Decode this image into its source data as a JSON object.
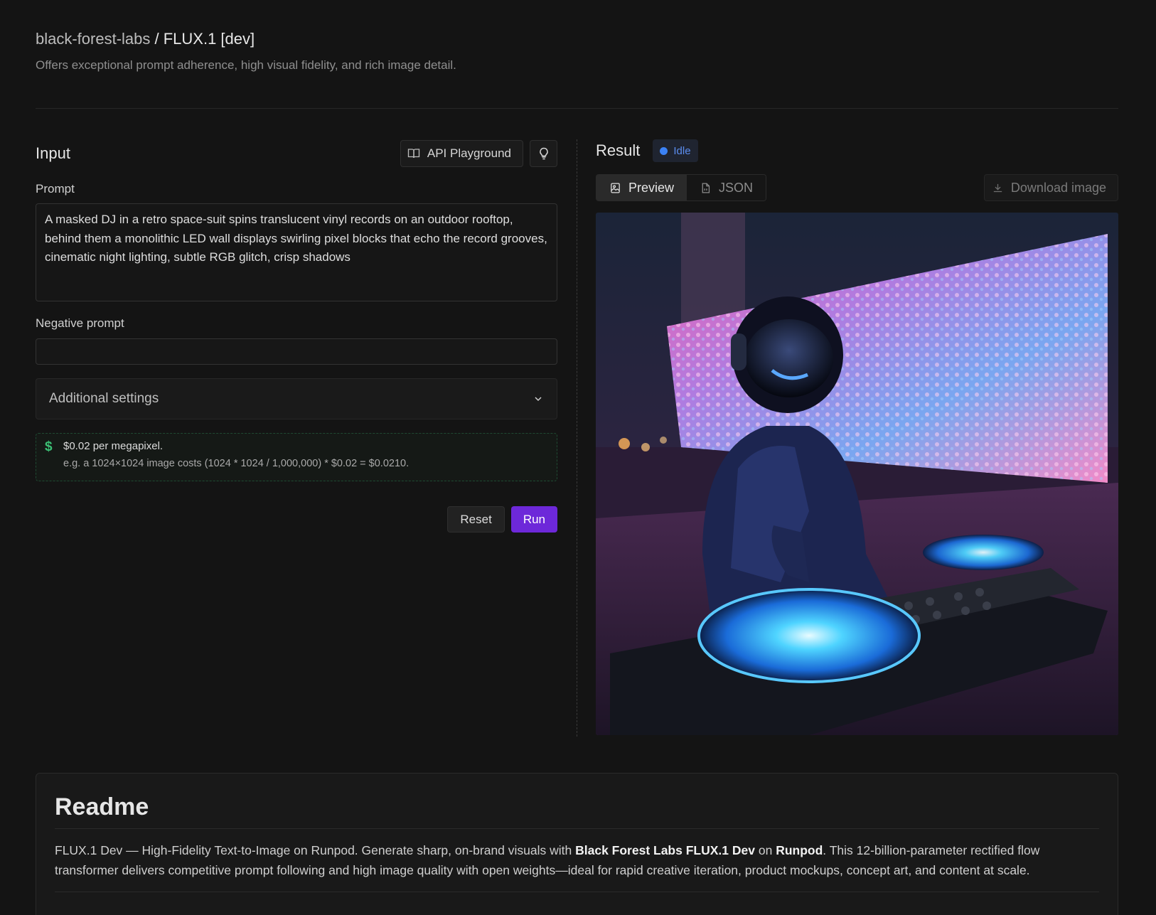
{
  "header": {
    "org": "black-forest-labs",
    "separator": " / ",
    "model": "FLUX.1 [dev]",
    "description": "Offers exceptional prompt adherence, high visual fidelity, and rich image detail."
  },
  "input_panel": {
    "title": "Input",
    "api_playground_label": "API Playground",
    "hint_icon": "lightbulb-icon",
    "prompt_label": "Prompt",
    "prompt_value": "A masked DJ in a retro space-suit spins translucent vinyl records on an outdoor rooftop, behind them a monolithic LED wall displays swirling pixel blocks that echo the record grooves, cinematic night lighting, subtle RGB glitch, crisp shadows",
    "negative_label": "Negative prompt",
    "negative_value": "",
    "settings_label": "Additional settings",
    "price_line": "$0.02 per megapixel.",
    "price_example": "e.g. a 1024×1024 image costs (1024 * 1024 / 1,000,000) * $0.02 = $0.0210.",
    "reset_label": "Reset",
    "run_label": "Run"
  },
  "result_panel": {
    "title": "Result",
    "status": "Idle",
    "tabs": [
      {
        "label": "Preview",
        "icon": "image-icon",
        "active": true
      },
      {
        "label": "JSON",
        "icon": "file-icon",
        "active": false
      }
    ],
    "download_label": "Download image"
  },
  "readme": {
    "title": "Readme",
    "text_1": "FLUX.1 Dev — High-Fidelity Text-to-Image on Runpod. Generate sharp, on-brand visuals with ",
    "bold_1": "Black Forest Labs FLUX.1 Dev",
    "text_2": " on ",
    "bold_2": "Runpod",
    "text_3": ". This 12-billion-parameter rectified flow transformer delivers competitive prompt following and high image quality with open weights—ideal for rapid creative iteration, product mockups, concept art, and content at scale."
  },
  "colors": {
    "background": "#141414",
    "accent": "#6d28d9",
    "status_blue": "#3b82f6",
    "price_green": "#3bbf74"
  }
}
